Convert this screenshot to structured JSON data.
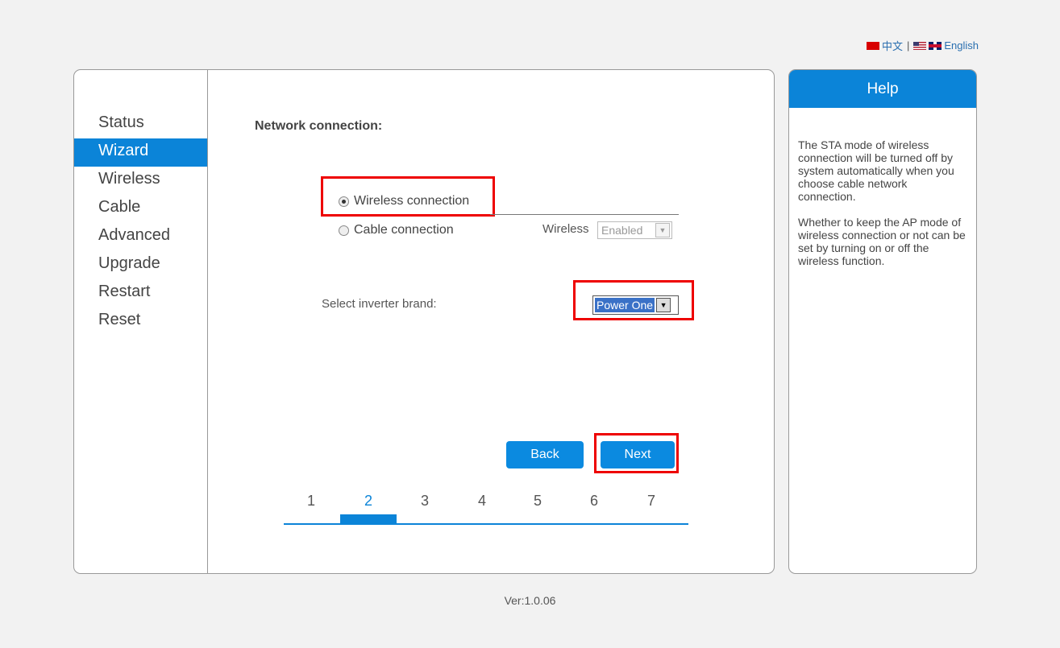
{
  "language": {
    "chinese": "中文",
    "separator": "|",
    "english": "English"
  },
  "sidebar": {
    "items": [
      {
        "label": "Status",
        "active": false
      },
      {
        "label": "Wizard",
        "active": true
      },
      {
        "label": "Wireless",
        "active": false
      },
      {
        "label": "Cable",
        "active": false
      },
      {
        "label": "Advanced",
        "active": false
      },
      {
        "label": "Upgrade",
        "active": false
      },
      {
        "label": "Restart",
        "active": false
      },
      {
        "label": "Reset",
        "active": false
      }
    ]
  },
  "main": {
    "title": "Network connection:",
    "options": [
      {
        "label": "Wireless connection",
        "checked": true
      },
      {
        "label": "Cable connection",
        "checked": false
      }
    ],
    "wireless_label": "Wireless",
    "wireless_value": "Enabled",
    "brand_label": "Select inverter brand:",
    "brand_value": "Power One",
    "back_label": "Back",
    "next_label": "Next",
    "steps": [
      "1",
      "2",
      "3",
      "4",
      "5",
      "6",
      "7"
    ],
    "current_step": "2"
  },
  "help": {
    "title": "Help",
    "paragraphs": [
      "The STA mode of wireless connection will be turned off by system automatically when you choose cable network connection.",
      "Whether to keep the AP mode of wireless connection or not can be set by turning on or off the wireless function."
    ]
  },
  "footer": {
    "version": "Ver:1.0.06"
  },
  "colors": {
    "accent": "#0b84d8",
    "highlight": "#e00000"
  }
}
